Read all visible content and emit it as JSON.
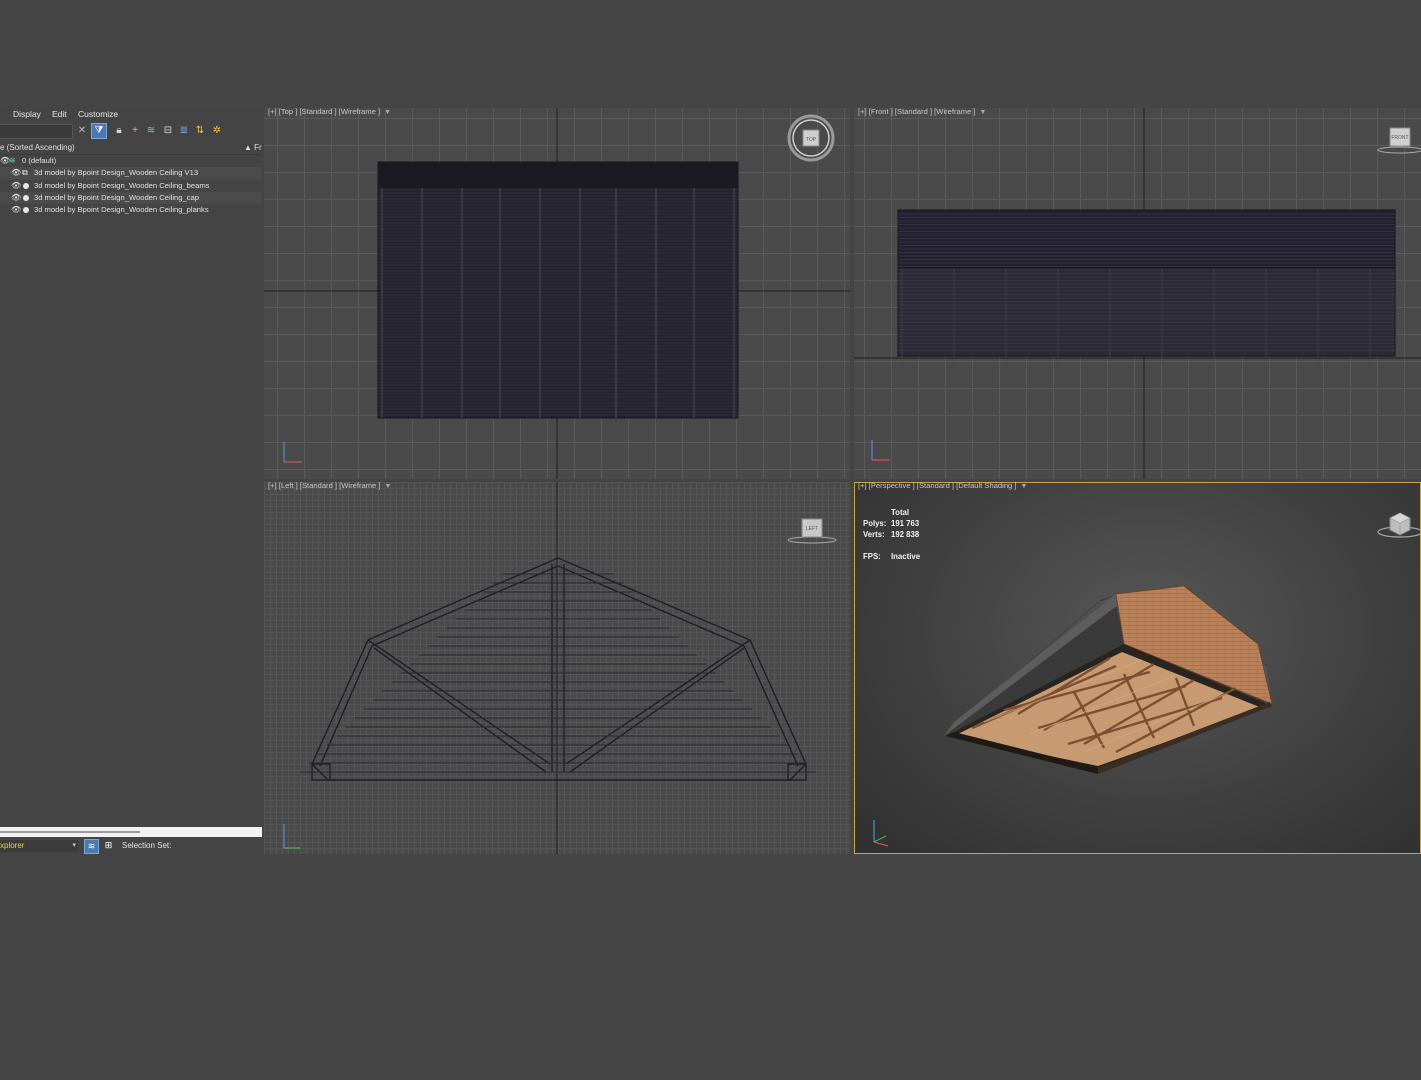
{
  "menubar": {
    "display": "Display",
    "edit": "Edit",
    "customize": "Customize"
  },
  "explorer": {
    "column_header": "e (Sorted Ascending)",
    "column_header_right": "▲ Fr",
    "layer_name": "0 (default)",
    "items": [
      {
        "label": "3d model by Bpoint Design_Wooden Ceiling V13"
      },
      {
        "label": "3d model by Bpoint Design_Wooden Ceiling_beams"
      },
      {
        "label": "3d model by Bpoint Design_Wooden Ceiling_cap"
      },
      {
        "label": "3d model by Bpoint Design_Wooden Ceiling_planks"
      }
    ],
    "footer": {
      "explorer_name": "xplorer",
      "selection_set_label": "Selection Set:"
    }
  },
  "viewports": {
    "top": {
      "label": "[+] [Top ] [Standard ] [Wireframe ]",
      "cube_label": "TOP"
    },
    "front": {
      "label": "[+] [Front ] [Standard ] [Wireframe ]",
      "cube_label": "FRONT"
    },
    "left": {
      "label": "[+] [Left ] [Standard ] [Wireframe ]",
      "cube_label": "LEFT"
    },
    "perspective": {
      "label": "[+] [Perspective ] [Standard ] [Default Shading ]",
      "stats": {
        "header": "Total",
        "polys_label": "Polys:",
        "polys_value": "191 763",
        "verts_label": "Verts:",
        "verts_value": "192 838",
        "fps_label": "FPS:",
        "fps_value": "Inactive"
      }
    }
  },
  "colors": {
    "background": "#454545",
    "grid_line": "#5b5b5b",
    "wire_dark": "#1f1d28",
    "active_viewport_border": "#c8a640",
    "toolbar_active": "#4a7ab0",
    "wood": "#b07a52"
  },
  "icons": {
    "menubar": [],
    "toolbar": [
      "clear-search-icon",
      "filter-icon",
      "lock-icon",
      "add-icon",
      "layers-icon",
      "hierarchy-icon",
      "stack-icon",
      "sort-icon",
      "settings-icon"
    ],
    "tree": [
      "eye-icon",
      "layer-icon",
      "object-icon"
    ]
  }
}
